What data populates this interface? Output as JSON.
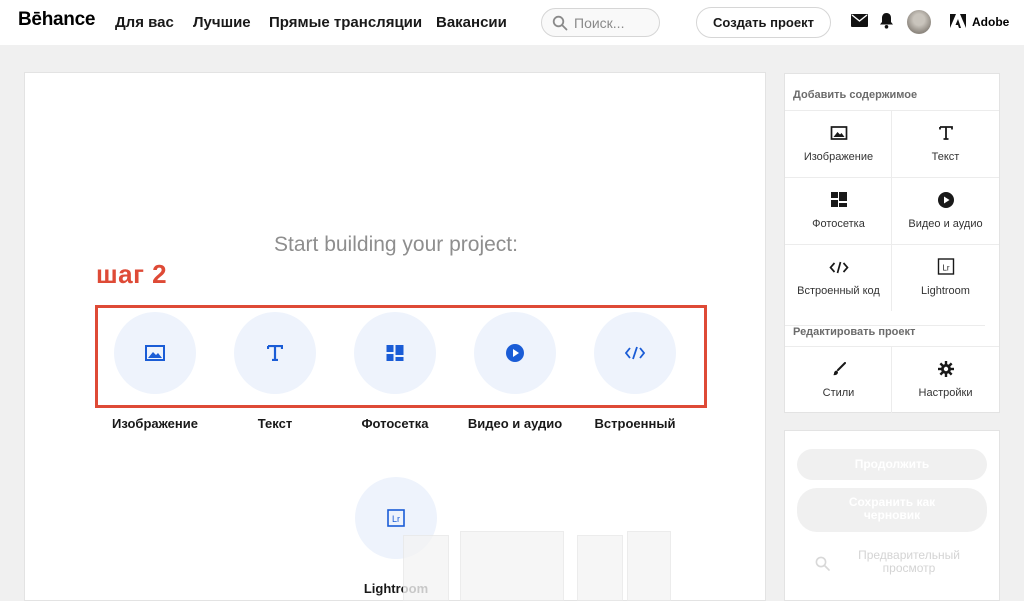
{
  "nav": {
    "logo": "Bēhance",
    "links": [
      "Для вас",
      "Лучшие",
      "Прямые трансляции",
      "Вакансии"
    ],
    "search_placeholder": "Поиск...",
    "create_button": "Создать проект",
    "adobe_label": "Adobe"
  },
  "canvas": {
    "start_title": "Start building your project:",
    "step_label": "шаг 2",
    "items": [
      {
        "label": "Изображение",
        "icon": "image-icon"
      },
      {
        "label": "Текст",
        "icon": "text-icon"
      },
      {
        "label": "Фотосетка",
        "icon": "photo-grid-icon"
      },
      {
        "label": "Видео и аудио",
        "icon": "play-icon"
      },
      {
        "label": "Встроенный",
        "icon": "embed-code-icon"
      },
      {
        "label": "Lightroom",
        "icon": "lightroom-icon"
      }
    ]
  },
  "panel": {
    "add_heading": "Добавить содержимое",
    "add_items": [
      {
        "label": "Изображение",
        "icon": "image-icon"
      },
      {
        "label": "Текст",
        "icon": "text-icon"
      },
      {
        "label": "Фотосетка",
        "icon": "photo-grid-icon"
      },
      {
        "label": "Видео и аудио",
        "icon": "play-icon"
      },
      {
        "label": "Встроенный код",
        "icon": "embed-code-icon"
      },
      {
        "label": "Lightroom",
        "icon": "lightroom-icon"
      }
    ],
    "edit_heading": "Редактировать проект",
    "edit_items": [
      {
        "label": "Стили",
        "icon": "brush-icon"
      },
      {
        "label": "Настройки",
        "icon": "gear-icon"
      }
    ]
  },
  "actions": {
    "continue": "Продолжить",
    "save_draft": "Сохранить как черновик",
    "preview": "Предварительный просмотр"
  },
  "colors": {
    "accent_blue": "#1a5cd6",
    "annotation_red": "#de4a36",
    "circle_bg": "#eef3fc"
  }
}
